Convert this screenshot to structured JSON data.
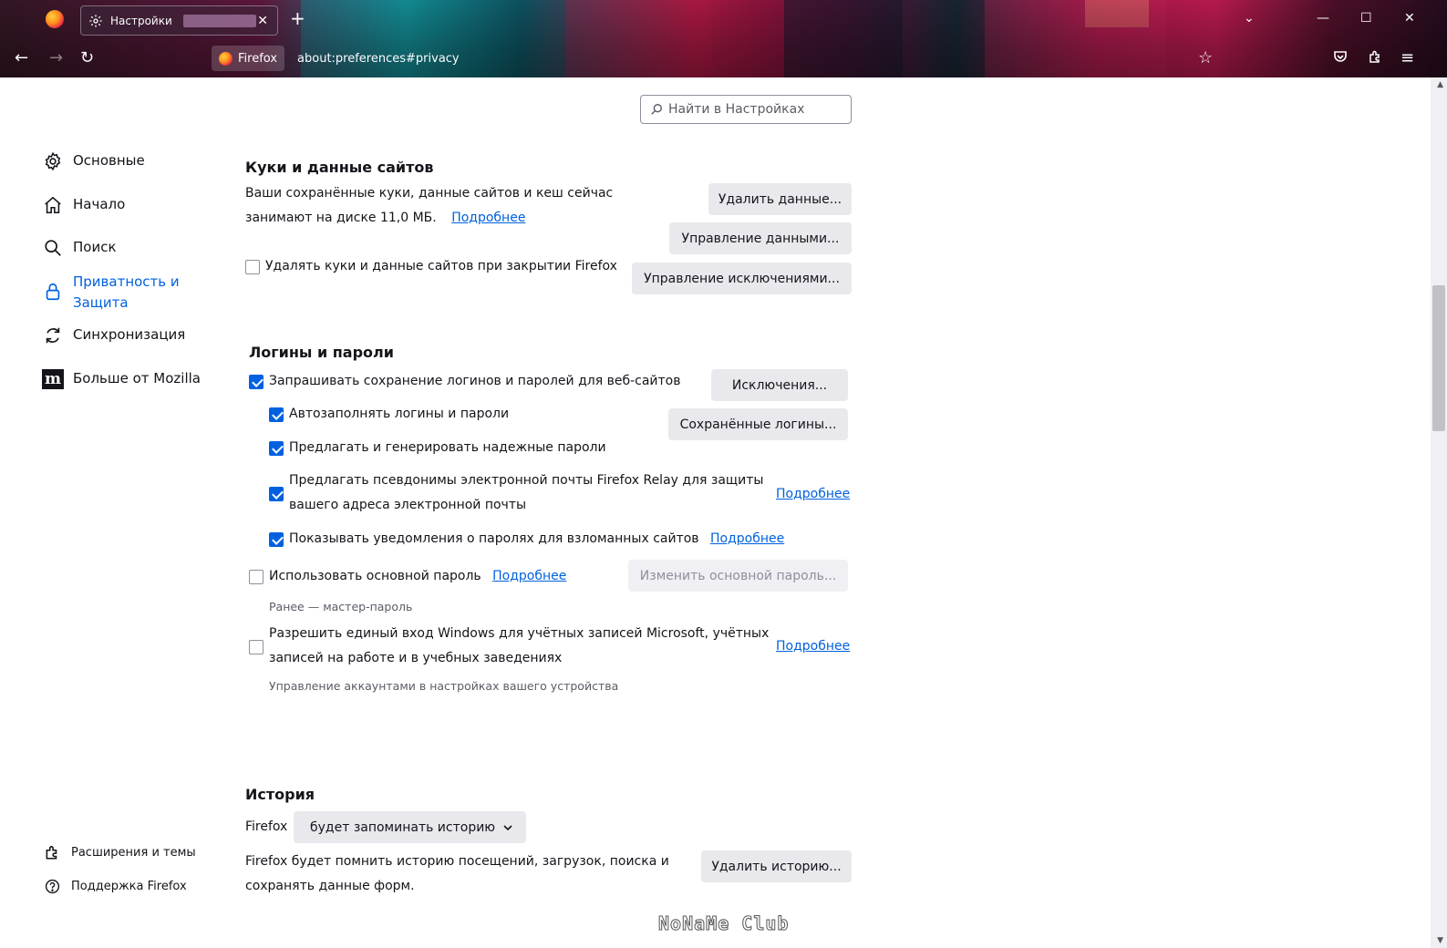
{
  "tab": {
    "title": "Настройки",
    "close": "✕"
  },
  "nav": {
    "identity_label": "Firefox",
    "url": "about:preferences#privacy"
  },
  "search": {
    "placeholder": "Найти в Настройках"
  },
  "sidebar": {
    "items": [
      {
        "label": "Основные",
        "icon": "gear-icon"
      },
      {
        "label": "Начало",
        "icon": "home-icon"
      },
      {
        "label": "Поиск",
        "icon": "search-icon"
      },
      {
        "label": "Приватность и Защита",
        "icon": "lock-icon",
        "active": true
      },
      {
        "label": "Синхронизация",
        "icon": "sync-icon"
      },
      {
        "label": "Больше от Mozilla",
        "icon": "mozilla-icon"
      }
    ],
    "footer": [
      {
        "label": "Расширения и темы",
        "icon": "puzzle-icon"
      },
      {
        "label": "Поддержка Firefox",
        "icon": "help-icon"
      }
    ]
  },
  "cookies": {
    "heading": "Куки и данные сайтов",
    "desc_line1": "Ваши сохранённые куки, данные сайтов и кеш сейчас",
    "desc_line2": "занимают на диске 11,0 МБ.",
    "learn_more": "Подробнее",
    "delete_on_close": "Удалять куки и данные сайтов при закрытии Firefox",
    "btn_clear": "Удалить данные...",
    "btn_manage": "Управление данными...",
    "btn_exceptions": "Управление исключениями..."
  },
  "logins": {
    "heading": "Логины и пароли",
    "ask_save": "Запрашивать сохранение логинов и паролей для веб-сайтов",
    "autofill": "Автозаполнять логины и пароли",
    "suggest": "Предлагать и генерировать надежные пароли",
    "relay_line1": "Предлагать псевдонимы электронной почты Firefox Relay для защиты",
    "relay_line2": "вашего адреса электронной почты",
    "relay_learn_more": "Подробнее",
    "breach": "Показывать уведомления о паролях для взломанных сайтов",
    "breach_learn_more": "Подробнее",
    "primary_password": "Использовать основной пароль",
    "primary_learn_more": "Подробнее",
    "primary_note": "Ранее — мастер-пароль",
    "sso_line1": "Разрешить единый вход Windows для учётных записей Microsoft, учётных",
    "sso_line2": "записей на работе и в учебных заведениях",
    "sso_learn_more": "Подробнее",
    "sso_note": "Управление аккаунтами в настройках вашего устройства",
    "btn_exceptions": "Исключения...",
    "btn_saved": "Сохранённые логины...",
    "btn_change_primary": "Изменить основной пароль..."
  },
  "history": {
    "heading": "История",
    "prefix": "Firefox",
    "mode": "будет запоминать историю",
    "desc_line1": "Firefox будет помнить историю посещений, загрузок, поиска и",
    "desc_line2": "сохранять данные форм.",
    "btn_clear": "Удалить историю..."
  },
  "watermark": "NoNaMe Club"
}
